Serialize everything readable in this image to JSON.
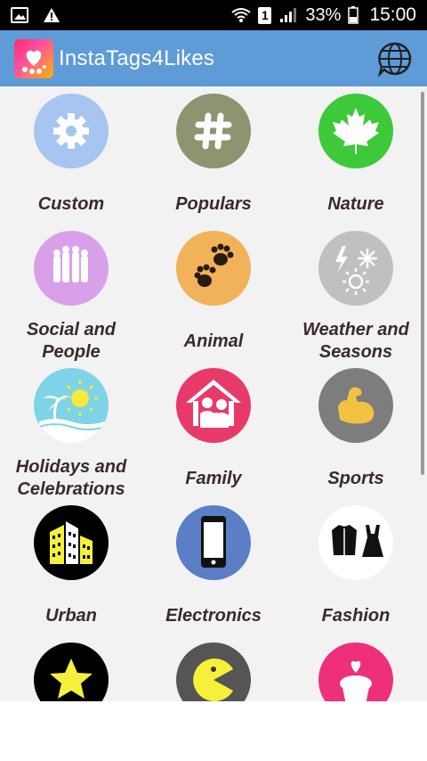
{
  "status_bar": {
    "signal_percent": "33%",
    "sim_slot": "1",
    "time": "15:00"
  },
  "app_bar": {
    "title": "InstaTags4Likes"
  },
  "categories": [
    {
      "label": "Custom",
      "color": "#a8c4f0",
      "icon": "gear-icon"
    },
    {
      "label": "Populars",
      "color": "#8c9470",
      "icon": "hashtag-icon"
    },
    {
      "label": "Nature",
      "color": "#3ec93a",
      "icon": "maple-leaf-icon"
    },
    {
      "label": "Social and People",
      "color": "#d9a0ea",
      "icon": "people-icon"
    },
    {
      "label": "Animal",
      "color": "#f2b25a",
      "icon": "paw-icon"
    },
    {
      "label": "Weather and Seasons",
      "color": "#c0c0c0",
      "icon": "weather-icon"
    },
    {
      "label": "Holidays and Celebrations",
      "color": "#7ed3e6",
      "icon": "beach-icon"
    },
    {
      "label": "Family",
      "color": "#e83a6a",
      "icon": "family-house-icon"
    },
    {
      "label": "Sports",
      "color": "#7d7d7d",
      "icon": "muscle-arm-icon"
    },
    {
      "label": "Urban",
      "color": "#000000",
      "icon": "buildings-icon"
    },
    {
      "label": "Electronics",
      "color": "#5b7fc6",
      "icon": "phone-icon"
    },
    {
      "label": "Fashion",
      "color": "#ffffff",
      "icon": "clothes-icon"
    },
    {
      "label": "",
      "color": "#000000",
      "icon": "star-icon"
    },
    {
      "label": "",
      "color": "#555555",
      "icon": "pacman-icon"
    },
    {
      "label": "",
      "color": "#ee2f7a",
      "icon": "cupcake-icon"
    }
  ]
}
